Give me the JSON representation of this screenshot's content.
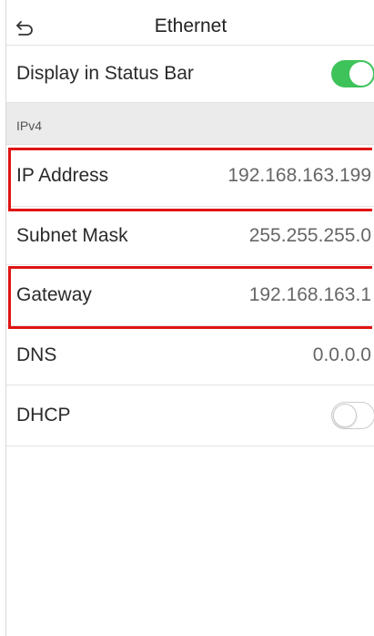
{
  "header": {
    "title": "Ethernet",
    "back_icon": "back-arrow-icon"
  },
  "status_bar_row": {
    "label": "Display in Status Bar",
    "toggle_state": "on"
  },
  "section": {
    "label": "IPv4"
  },
  "rows": [
    {
      "label": "IP Address",
      "value": "192.168.163.199"
    },
    {
      "label": "Subnet Mask",
      "value": "255.255.255.0"
    },
    {
      "label": "Gateway",
      "value": "192.168.163.1"
    },
    {
      "label": "DNS",
      "value": "0.0.0.0"
    },
    {
      "label": "DHCP",
      "toggle_state": "off"
    }
  ],
  "colors": {
    "toggle_on": "#3ec35a",
    "highlight": "#e01414",
    "section_bg": "#ebebeb"
  }
}
